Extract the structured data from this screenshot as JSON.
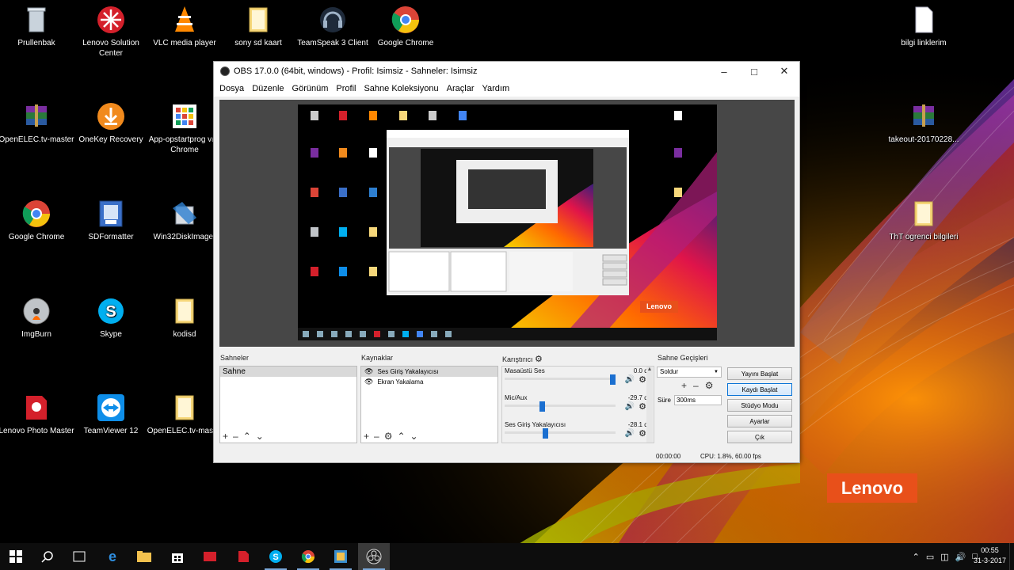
{
  "desktop": {
    "icons": [
      {
        "label": "Prullenbak",
        "icon": "recycle-bin-icon"
      },
      {
        "label": "Lenovo Solution Center",
        "icon": "lenovo-solution-center-icon"
      },
      {
        "label": "VLC media player",
        "icon": "vlc-icon"
      },
      {
        "label": "sony sd kaart",
        "icon": "folder-icon"
      },
      {
        "label": "TeamSpeak 3 Client",
        "icon": "teamspeak-icon"
      },
      {
        "label": "Google Chrome",
        "icon": "chrome-icon"
      },
      {
        "label": "bilgi linklerim",
        "icon": "document-icon"
      },
      {
        "label": "OpenELEC.tv-master",
        "icon": "winrar-icon"
      },
      {
        "label": "OneKey Recovery",
        "icon": "onekey-recovery-icon"
      },
      {
        "label": "App-opstartprog van Chrome",
        "icon": "app-launcher-icon"
      },
      {
        "label": "takeout-20170228...",
        "icon": "winrar-icon"
      },
      {
        "label": "Google Chrome",
        "icon": "chrome-icon"
      },
      {
        "label": "SDFormatter",
        "icon": "sdformatter-icon"
      },
      {
        "label": "Win32DiskImager",
        "icon": "disk-imager-icon"
      },
      {
        "label": "ThT ogrenci bilgileri",
        "icon": "folder-icon"
      },
      {
        "label": "ImgBurn",
        "icon": "imgburn-icon"
      },
      {
        "label": "Skype",
        "icon": "skype-icon"
      },
      {
        "label": "kodisd",
        "icon": "folder-icon"
      },
      {
        "label": "Lenovo Photo Master",
        "icon": "lenovo-photo-master-icon"
      },
      {
        "label": "TeamViewer 12",
        "icon": "teamviewer-icon"
      },
      {
        "label": "OpenELEC.tv-mast...",
        "icon": "folder-icon"
      }
    ],
    "wallpaper_logo": "Lenovo"
  },
  "obs": {
    "title": "OBS 17.0.0 (64bit, windows) - Profil: Isimsiz - Sahneler: Isimsiz",
    "menu": [
      "Dosya",
      "Düzenle",
      "Görünüm",
      "Profil",
      "Sahne Koleksiyonu",
      "Araçlar",
      "Yardım"
    ],
    "preview_logo": "Lenovo",
    "scenes": {
      "title": "Sahneler",
      "items": [
        "Sahne"
      ]
    },
    "sources": {
      "title": "Kaynaklar",
      "items": [
        "Ses Giriş Yakalayıcısı",
        "Ekran Yakalama"
      ]
    },
    "mixer": {
      "title": "Karıştırıcı",
      "channels": [
        {
          "name": "Masaüstü Ses",
          "db": "0.0 dB",
          "level": 1.0,
          "color": "#1b6fd0"
        },
        {
          "name": "Mic/Aux",
          "db": "-29.7 dB",
          "level": 0.33,
          "color": "#1b6fd0"
        },
        {
          "name": "Ses Giriş Yakalayıcısı",
          "db": "-28.1 dB",
          "level": 0.36,
          "color": "#1b6fd0"
        }
      ]
    },
    "transitions": {
      "title": "Sahne Geçişleri",
      "selected": "Soldur",
      "duration_label": "Süre",
      "duration_value": "300ms"
    },
    "buttons": {
      "start_streaming": "Yayını Başlat",
      "start_recording": "Kaydı Başlat",
      "studio_mode": "Stüdyo Modu",
      "settings": "Ayarlar",
      "exit": "Çık"
    },
    "status": {
      "time": "00:00:00",
      "cpu": "CPU: 1.8%, 60.00 fps"
    }
  },
  "taskbar": {
    "items": [
      "start-icon",
      "search-icon",
      "task-view-icon",
      "edge-icon",
      "file-explorer-icon",
      "store-icon",
      "app-red-icon",
      "app-red2-icon",
      "skype-icon",
      "chrome-icon",
      "app-blue-icon",
      "obs-icon"
    ],
    "time": "00:55",
    "date": "31-3-2017"
  },
  "colors": {
    "accent": "#0a74d6",
    "lenovo": "#e8501a"
  }
}
